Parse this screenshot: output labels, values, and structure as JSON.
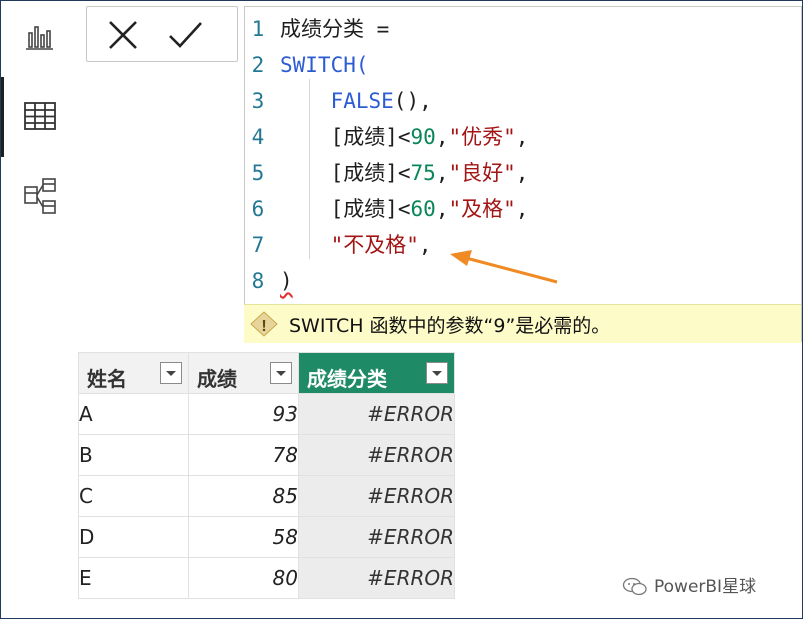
{
  "formula": {
    "lines": [
      {
        "num": "1",
        "tokens": [
          {
            "t": "成绩分类 =",
            "c": "plain"
          }
        ]
      },
      {
        "num": "2",
        "tokens": [
          {
            "t": "SWITCH(",
            "c": "kw"
          }
        ]
      },
      {
        "num": "3",
        "tokens": [
          {
            "t": "    ",
            "c": "plain"
          },
          {
            "t": "FALSE",
            "c": "kw"
          },
          {
            "t": "(),",
            "c": "plain"
          }
        ]
      },
      {
        "num": "4",
        "tokens": [
          {
            "t": "    [成绩]<",
            "c": "plain"
          },
          {
            "t": "90",
            "c": "num"
          },
          {
            "t": ",",
            "c": "plain"
          },
          {
            "t": "\"优秀\"",
            "c": "str"
          },
          {
            "t": ",",
            "c": "plain"
          }
        ]
      },
      {
        "num": "5",
        "tokens": [
          {
            "t": "    [成绩]<",
            "c": "plain"
          },
          {
            "t": "75",
            "c": "num"
          },
          {
            "t": ",",
            "c": "plain"
          },
          {
            "t": "\"良好\"",
            "c": "str"
          },
          {
            "t": ",",
            "c": "plain"
          }
        ]
      },
      {
        "num": "6",
        "tokens": [
          {
            "t": "    [成绩]<",
            "c": "plain"
          },
          {
            "t": "60",
            "c": "num"
          },
          {
            "t": ",",
            "c": "plain"
          },
          {
            "t": "\"及格\"",
            "c": "str"
          },
          {
            "t": ",",
            "c": "plain"
          }
        ]
      },
      {
        "num": "7",
        "tokens": [
          {
            "t": "    ",
            "c": "plain"
          },
          {
            "t": "\"不及格\"",
            "c": "str"
          },
          {
            "t": ",",
            "c": "plain"
          }
        ]
      },
      {
        "num": "8",
        "tokens": [
          {
            "t": ")",
            "c": "plain"
          }
        ]
      }
    ]
  },
  "error": {
    "message": "SWITCH 函数中的参数“9”是必需的。"
  },
  "table": {
    "headers": [
      "姓名",
      "成绩",
      "成绩分类"
    ],
    "rows": [
      {
        "name": "A",
        "score": "93",
        "category": "#ERROR"
      },
      {
        "name": "B",
        "score": "78",
        "category": "#ERROR"
      },
      {
        "name": "C",
        "score": "85",
        "category": "#ERROR"
      },
      {
        "name": "D",
        "score": "58",
        "category": "#ERROR"
      },
      {
        "name": "E",
        "score": "80",
        "category": "#ERROR"
      }
    ]
  },
  "watermark": {
    "text": "PowerBI星球"
  },
  "colors": {
    "selected_column": "#1e8a66",
    "keyword": "#2b5cd3",
    "string": "#a31515",
    "number": "#098658",
    "error_bar": "#fdfbc8",
    "arrow": "#f08a24"
  },
  "icons": [
    "report-view-icon",
    "table-view-icon",
    "model-view-icon",
    "cancel-icon",
    "commit-icon",
    "warning-icon"
  ]
}
